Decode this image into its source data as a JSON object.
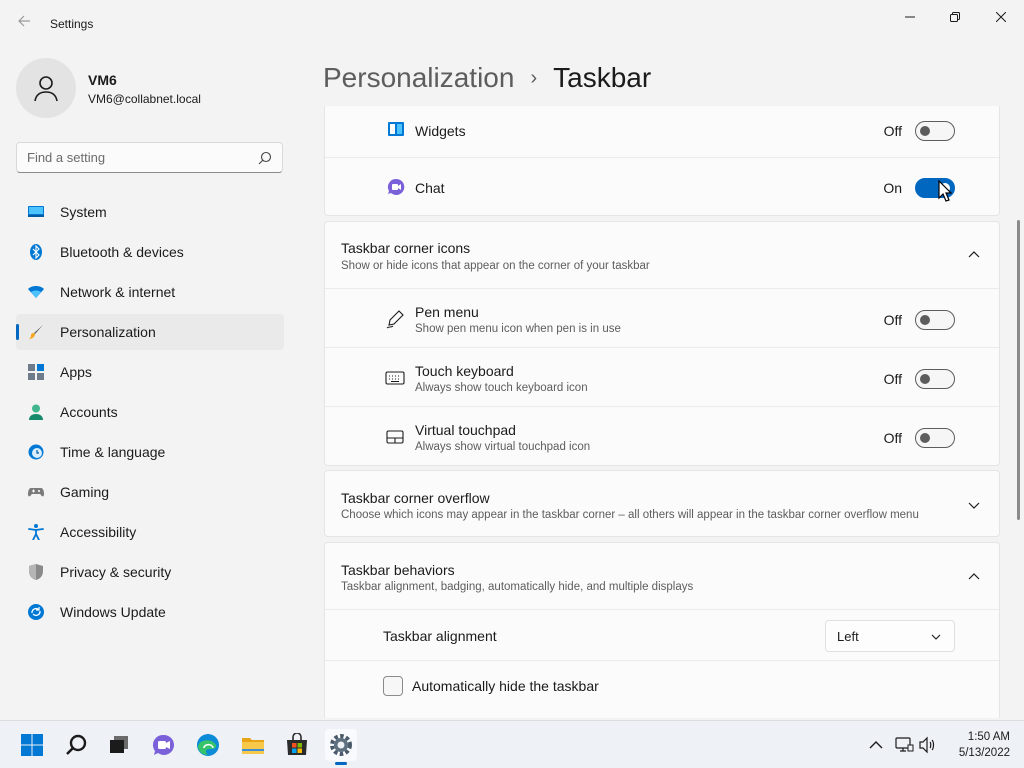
{
  "window": {
    "app_title": "Settings"
  },
  "profile": {
    "name": "VM6",
    "email": "VM6@collabnet.local"
  },
  "search": {
    "placeholder": "Find a setting"
  },
  "sidebar": {
    "items": [
      {
        "label": "System",
        "icon": "system-icon"
      },
      {
        "label": "Bluetooth & devices",
        "icon": "bluetooth-icon"
      },
      {
        "label": "Network & internet",
        "icon": "wifi-icon"
      },
      {
        "label": "Personalization",
        "icon": "brush-icon",
        "active": true
      },
      {
        "label": "Apps",
        "icon": "apps-icon"
      },
      {
        "label": "Accounts",
        "icon": "accounts-icon"
      },
      {
        "label": "Time & language",
        "icon": "time-language-icon"
      },
      {
        "label": "Gaming",
        "icon": "gaming-icon"
      },
      {
        "label": "Accessibility",
        "icon": "accessibility-icon"
      },
      {
        "label": "Privacy & security",
        "icon": "shield-icon"
      },
      {
        "label": "Windows Update",
        "icon": "windows-update-icon"
      }
    ]
  },
  "breadcrumb": {
    "parent": "Personalization",
    "separator": "›",
    "current": "Taskbar"
  },
  "taskbar_items": {
    "widgets": {
      "title": "Widgets",
      "state": "Off",
      "on": false
    },
    "chat": {
      "title": "Chat",
      "state": "On",
      "on": true
    }
  },
  "corner_icons": {
    "title": "Taskbar corner icons",
    "subtitle": "Show or hide icons that appear on the corner of your taskbar",
    "expanded": true,
    "items": [
      {
        "title": "Pen menu",
        "subtitle": "Show pen menu icon when pen is in use",
        "state": "Off"
      },
      {
        "title": "Touch keyboard",
        "subtitle": "Always show touch keyboard icon",
        "state": "Off"
      },
      {
        "title": "Virtual touchpad",
        "subtitle": "Always show virtual touchpad icon",
        "state": "Off"
      }
    ]
  },
  "corner_overflow": {
    "title": "Taskbar corner overflow",
    "subtitle": "Choose which icons may appear in the taskbar corner – all others will appear in the taskbar corner overflow menu",
    "expanded": false
  },
  "behaviors": {
    "title": "Taskbar behaviors",
    "subtitle": "Taskbar alignment, badging, automatically hide, and multiple displays",
    "expanded": true,
    "alignment_label": "Taskbar alignment",
    "alignment_value": "Left",
    "autohide_label": "Automatically hide the taskbar",
    "autohide_checked": false
  },
  "taskbar": {
    "apps": [
      "start-icon",
      "search-icon",
      "task-view-icon",
      "chat-icon",
      "edge-icon",
      "file-explorer-icon",
      "store-icon",
      "settings-icon"
    ],
    "time": "1:50 AM",
    "date": "5/13/2022"
  },
  "colors": {
    "accent": "#0067c0",
    "background": "#f3f3f3",
    "card": "#fbfbfb"
  }
}
